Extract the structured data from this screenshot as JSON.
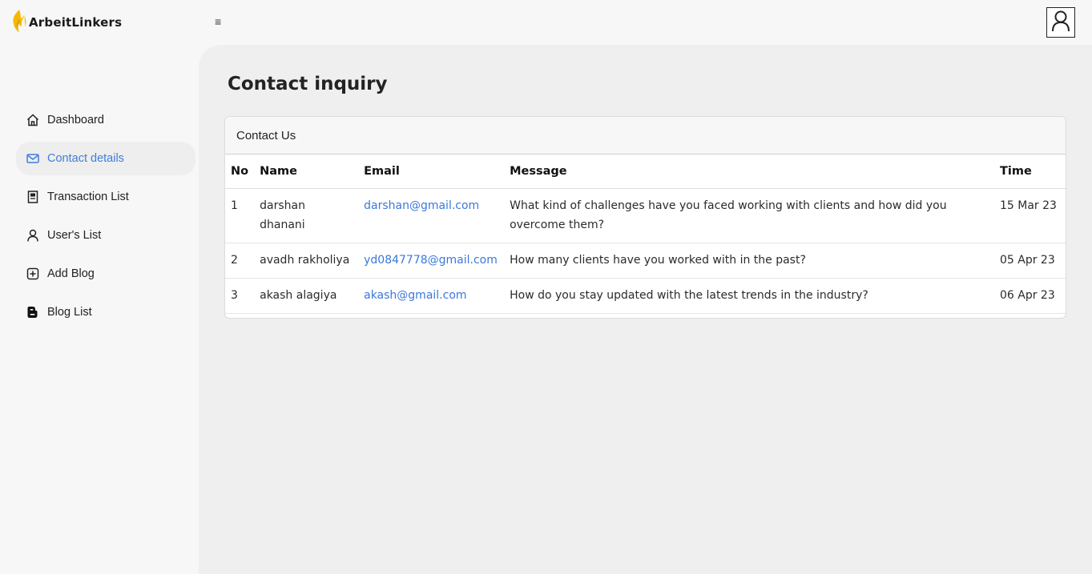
{
  "brand": {
    "name": "ArbeitLinkers"
  },
  "topbar": {
    "menu_icon": "≡"
  },
  "sidebar": {
    "items": [
      {
        "label": "Dashboard",
        "icon": "home-icon"
      },
      {
        "label": "Contact details",
        "icon": "mail-icon",
        "active": true
      },
      {
        "label": "Transaction List",
        "icon": "ledger-icon"
      },
      {
        "label": "User's List",
        "icon": "user-icon"
      },
      {
        "label": "Add Blog",
        "icon": "plus-square-icon"
      },
      {
        "label": "Blog List",
        "icon": "blogger-icon"
      }
    ]
  },
  "main": {
    "title": "Contact inquiry",
    "card": {
      "header": "Contact Us",
      "columns": {
        "no": "No",
        "name": "Name",
        "email": "Email",
        "message": "Message",
        "time": "Time"
      },
      "rows": [
        {
          "no": "1",
          "name": "darshan dhanani",
          "email": "darshan@gmail.com",
          "message": "What kind of challenges have you faced working with clients and how did you overcome them?",
          "time": "15 Mar 23"
        },
        {
          "no": "2",
          "name": "avadh rakholiya",
          "email": "yd0847778@gmail.com",
          "message": "How many clients have you worked with in the past?",
          "time": "05 Apr 23"
        },
        {
          "no": "3",
          "name": "akash alagiya",
          "email": "akash@gmail.com",
          "message": "How do you stay updated with the latest trends in the industry?",
          "time": "06 Apr 23"
        }
      ]
    }
  },
  "colors": {
    "accent": "#3f7de0",
    "logo": "#f5b800"
  }
}
